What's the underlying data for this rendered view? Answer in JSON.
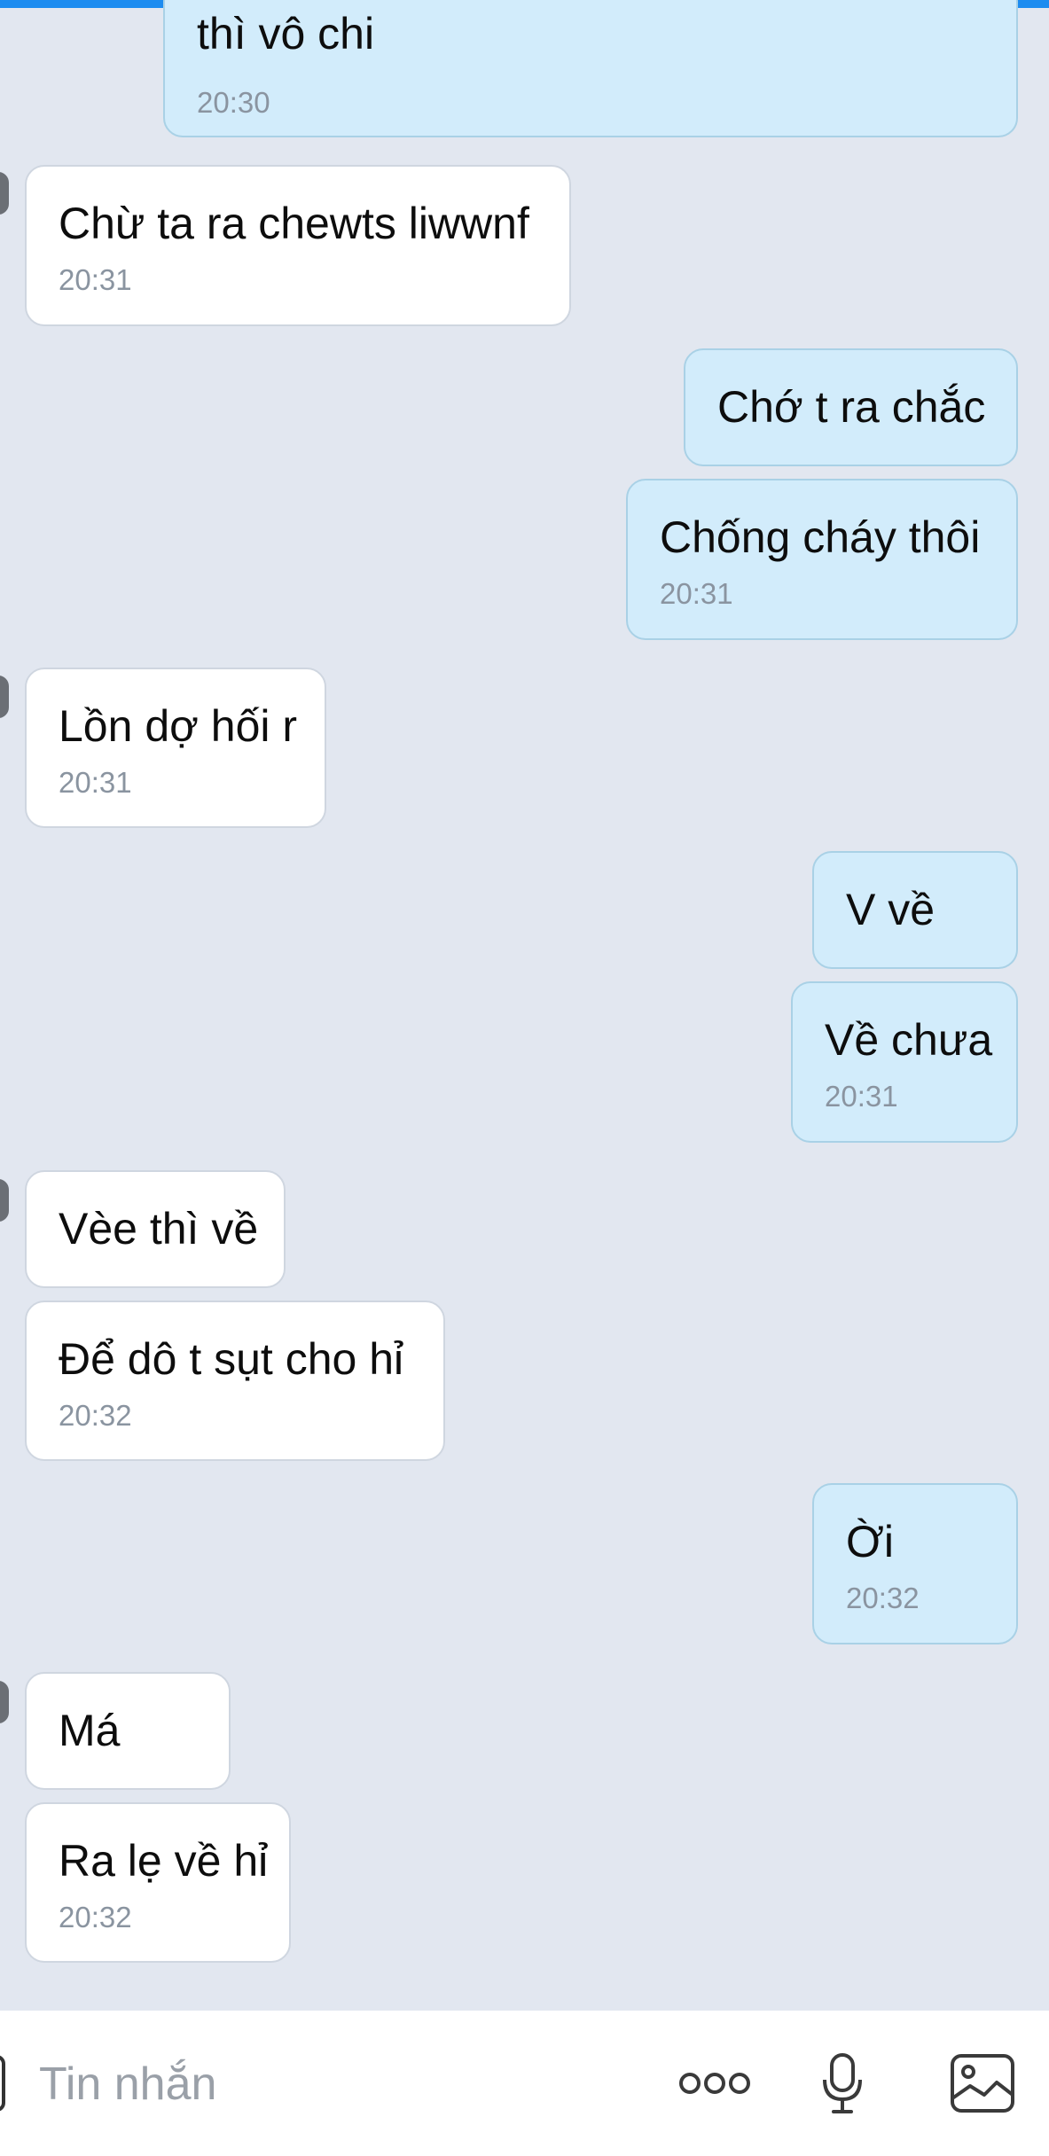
{
  "messages": [
    {
      "side": "out",
      "text": "thì vô chi",
      "time": "20:30"
    },
    {
      "side": "in",
      "text": "Chừ ta ra chewts liwwnf",
      "time": "20:31",
      "avatar": true
    },
    {
      "side": "out",
      "text": "Chớ t ra chắc",
      "time": ""
    },
    {
      "side": "out",
      "text": "Chống cháy thôi",
      "time": "20:31"
    },
    {
      "side": "in",
      "text": "Lồn dợ hối r",
      "time": "20:31",
      "avatar": true
    },
    {
      "side": "out",
      "text": "V về",
      "time": ""
    },
    {
      "side": "out",
      "text": "Về chưa",
      "time": "20:31"
    },
    {
      "side": "in",
      "text": "Vèe thì về",
      "time": "",
      "avatar": true
    },
    {
      "side": "in",
      "text": "Để dô t sụt cho hỉ",
      "time": "20:32"
    },
    {
      "side": "out",
      "text": "Ời",
      "time": "20:32"
    },
    {
      "side": "in",
      "text": "Má",
      "time": "",
      "avatar": true
    },
    {
      "side": "in",
      "text": "Ra lẹ về hỉ",
      "time": "20:32"
    }
  ],
  "composer": {
    "placeholder": "Tin nhắn",
    "icons": [
      "more-icon",
      "microphone-icon",
      "image-icon"
    ]
  },
  "colors": {
    "accent": "#1d8cf0",
    "outgoing_bubble": "#d2ecfb",
    "incoming_bubble": "#ffffff",
    "background": "#e2e7f0"
  }
}
